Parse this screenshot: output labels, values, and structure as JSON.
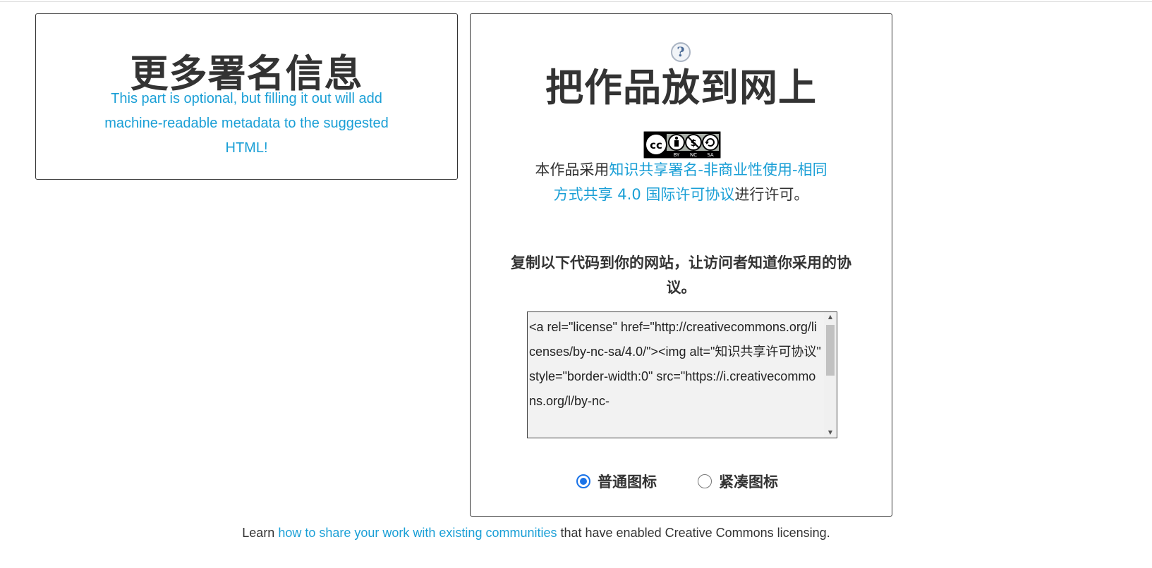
{
  "attribution_card": {
    "title": "更多署名信息",
    "description": "This part is optional, but filling it out will add machine-readable metadata to the suggested HTML!"
  },
  "online_card": {
    "help_icon": "question-mark-icon",
    "help_glyph": "?",
    "title": "把作品放到网上",
    "badge": "cc-by-nc-sa-badge",
    "badge_labels": [
      "BY",
      "NC",
      "SA"
    ],
    "license_prefix": "本作品采用",
    "license_link": "知识共享署名-非商业性使用-相同方式共享 4.0 国际许可协议",
    "license_suffix": "进行许可。",
    "copy_instruction": "复制以下代码到你的网站，让访问者知道你采用的协议。",
    "code": "<a rel=\"license\" href=\"http://creativecommons.org/licenses/by-nc-sa/4.0/\"><img alt=\"知识共享许可协议\" style=\"border-width:0\" src=\"https://i.creativecommons.org/l/by-nc-",
    "radio_normal": "普通图标",
    "radio_compact": "紧凑图标",
    "selected_option": "普通图标"
  },
  "footer": {
    "prefix": "Learn ",
    "link": "how to share your work with existing communities",
    "suffix": " that have enabled Creative Commons licensing."
  },
  "colors": {
    "accent_link": "#1a9fd6",
    "text": "#333333",
    "radio_selected": "#1a73e8"
  }
}
